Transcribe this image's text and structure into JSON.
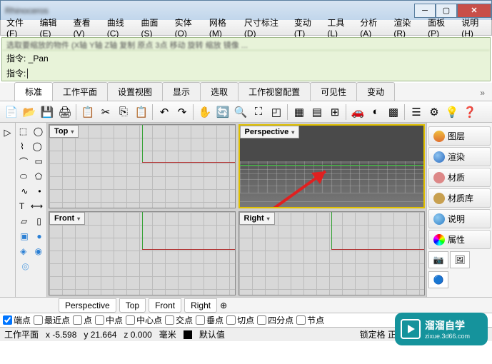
{
  "title": "Rhinoceros",
  "menu": [
    "文件(F)",
    "编辑(E)",
    "查看(V)",
    "曲线(C)",
    "曲面(S)",
    "实体(O)",
    "网格(M)",
    "尺寸标注(D)",
    "变动(T)",
    "工具(L)",
    "分析(A)",
    "渲染(R)",
    "面板(P)",
    "说明(H)"
  ],
  "cmd": {
    "history": "选取要缩放的物件 (X轴 Y轴 Z轴 复制 原点 3点 移动 旋转 缩放 镜像 ...",
    "line1": "指令: _Pan",
    "prompt": "指令:"
  },
  "tabs": [
    "标准",
    "工作平面",
    "设置视图",
    "显示",
    "选取",
    "工作视窗配置",
    "可见性",
    "变动"
  ],
  "active_tab": 0,
  "viewports": {
    "tl": "Top",
    "tr": "Perspective",
    "bl": "Front",
    "br": "Right"
  },
  "vptabs": [
    "Perspective",
    "Top",
    "Front",
    "Right"
  ],
  "rpanel": [
    {
      "label": "图层",
      "color": "linear-gradient(#f0c040,#e07030)"
    },
    {
      "label": "渲染",
      "color": "radial-gradient(circle at 35% 35%, #8fc4f0, #2a6abf)"
    },
    {
      "label": "材质",
      "color": "#d88"
    },
    {
      "label": "材质库",
      "color": "#c8a050"
    },
    {
      "label": "说明",
      "color": "radial-gradient(circle at 35% 35%, #90caf0, #2f7fc8)"
    },
    {
      "label": "属性",
      "color": "conic-gradient(red,yellow,lime,cyan,blue,magenta,red)"
    }
  ],
  "osnap": [
    "端点",
    "最近点",
    "点",
    "中点",
    "中心点",
    "交点",
    "垂点",
    "切点",
    "四分点",
    "节点"
  ],
  "osnap_checked": [
    true,
    false,
    false,
    false,
    false,
    false,
    false,
    false,
    false,
    false
  ],
  "status": {
    "plane": "工作平面",
    "x": "x -5.598",
    "y": "y 21.664",
    "z": "z 0.000",
    "unit": "毫米",
    "layer": "默认值",
    "extra": "锁定格 正交 平面模 物件锁 智能..."
  },
  "watermark": {
    "name": "溜溜自学",
    "url": "zixue.3d66.com"
  }
}
